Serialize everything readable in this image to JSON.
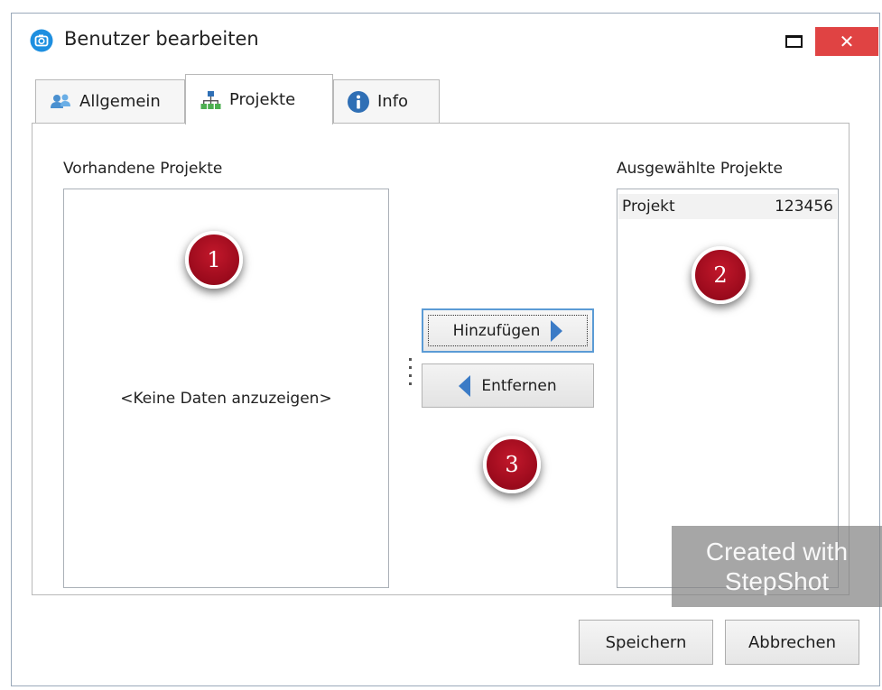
{
  "window": {
    "title": "Benutzer bearbeiten",
    "close_glyph": "✕",
    "colors": {
      "close_button": "#e04343",
      "frame": "#9aa9ba",
      "accent_blue": "#3b7bc6"
    }
  },
  "tabs": [
    {
      "label": "Allgemein",
      "icon": "users-icon",
      "active": false
    },
    {
      "label": "Projekte",
      "icon": "org-chart-icon",
      "active": true
    },
    {
      "label": "Info",
      "icon": "info-icon",
      "active": false
    }
  ],
  "available": {
    "label": "Vorhandene Projekte",
    "empty_text": "<Keine Daten anzuzeigen>"
  },
  "selected": {
    "label": "Ausgewählte Projekte",
    "rows": [
      {
        "name": "Projekt",
        "value": "123456"
      }
    ]
  },
  "actions": {
    "add_label": "Hinzufügen",
    "remove_label": "Entfernen"
  },
  "badges": [
    "1",
    "2",
    "3"
  ],
  "footer": {
    "save_label": "Speichern",
    "cancel_label": "Abbrechen"
  },
  "watermark": {
    "line1": "Created with",
    "line2": "StepShot"
  }
}
